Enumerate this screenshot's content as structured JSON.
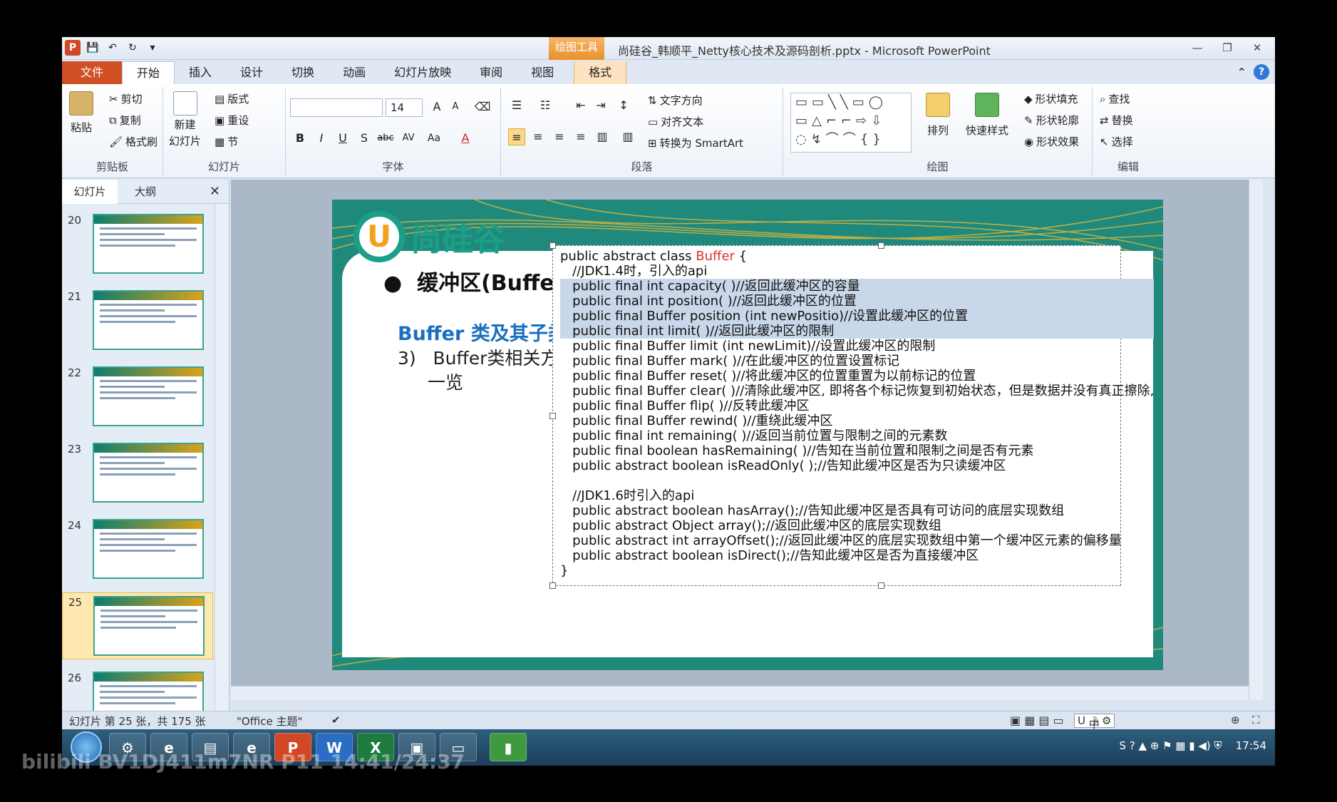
{
  "window": {
    "title": "尚硅谷_韩顺平_Netty核心技术及源码剖析.pptx - Microsoft PowerPoint",
    "context_tab_group": "绘图工具"
  },
  "tabs": [
    "文件",
    "开始",
    "插入",
    "设计",
    "切换",
    "动画",
    "幻灯片放映",
    "审阅",
    "视图",
    "格式"
  ],
  "ribbon": {
    "clipboard": {
      "paste": "粘贴",
      "cut": "剪切",
      "copy": "复制",
      "format_painter": "格式刷",
      "label": "剪贴板"
    },
    "slides": {
      "new_slide_1": "新建",
      "new_slide_2": "幻灯片",
      "layout": "版式",
      "reset": "重设",
      "section": "节",
      "label": "幻灯片"
    },
    "font": {
      "size": "14",
      "label": "字体"
    },
    "paragraph": {
      "text_direction": "文字方向",
      "align_text": "对齐文本",
      "convert_smartart": "转换为 SmartArt",
      "label": "段落"
    },
    "drawing": {
      "arrange": "排列",
      "quick_styles": "快速样式",
      "shape_fill": "形状填充",
      "shape_outline": "形状轮廓",
      "shape_effects": "形状效果",
      "label": "绘图"
    },
    "editing": {
      "find": "查找",
      "replace": "替换",
      "select": "选择",
      "label": "编辑"
    }
  },
  "pane": {
    "tab_slides": "幻灯片",
    "tab_outline": "大纲",
    "thumbnails": [
      {
        "num": "20"
      },
      {
        "num": "21"
      },
      {
        "num": "22"
      },
      {
        "num": "23"
      },
      {
        "num": "24"
      },
      {
        "num": "25"
      },
      {
        "num": "26"
      }
    ]
  },
  "slide": {
    "logo_text": "尚硅谷",
    "bullet": "缓冲区(Buffer)",
    "subtitle": "Buffer 类及其子类",
    "item_num": "3)",
    "item_text_1": "Buffer类相关方法",
    "item_text_2": "一览",
    "code_lines": [
      "public abstract class ",
      "   //JDK1.4时，引入的api",
      "   public final int capacity( )//返回此缓冲区的容量",
      "   public final int position( )//返回此缓冲区的位置",
      "   public final Buffer position (int newPositio)//设置此缓冲区的位置",
      "   public final int limit( )//返回此缓冲区的限制",
      "   public final Buffer limit (int newLimit)//设置此缓冲区的限制",
      "   public final Buffer mark( )//在此缓冲区的位置设置标记",
      "   public final Buffer reset( )//将此缓冲区的位置重置为以前标记的位置",
      "   public final Buffer clear( )//清除此缓冲区, 即将各个标记恢复到初始状态，但是数据并没有真正擦除,",
      "   public final Buffer flip( )//反转此缓冲区",
      "   public final Buffer rewind( )//重绕此缓冲区",
      "   public final int remaining( )//返回当前位置与限制之间的元素数",
      "   public final boolean hasRemaining( )//告知在当前位置和限制之间是否有元素",
      "   public abstract boolean isReadOnly( );//告知此缓冲区是否为只读缓冲区",
      "",
      "   //JDK1.6时引入的api",
      "   public abstract boolean hasArray();//告知此缓冲区是否具有可访问的底层实现数组",
      "   public abstract Object array();//返回此缓冲区的底层实现数组",
      "   public abstract int arrayOffset();//返回此缓冲区的底层实现数组中第一个缓冲区元素的偏移量",
      "   public abstract boolean isDirect();//告知此缓冲区是否为直接缓冲区",
      "}"
    ],
    "code_class_name": "Buffer",
    "code_open_brace": " {"
  },
  "status": {
    "slide_info": "幻灯片 第 25 张，共 175 张",
    "theme": "\"Office 主题\""
  },
  "taskbar": {
    "clock": "17:54",
    "ime": "中"
  },
  "watermark": "BV1DJ411m7NR P11 14:41/24:37",
  "colors": {
    "accent": "#d04f24",
    "slide_teal": "#1f8a7c",
    "subtitle_blue": "#1a6fc0",
    "selection": "#c9d7ea"
  }
}
